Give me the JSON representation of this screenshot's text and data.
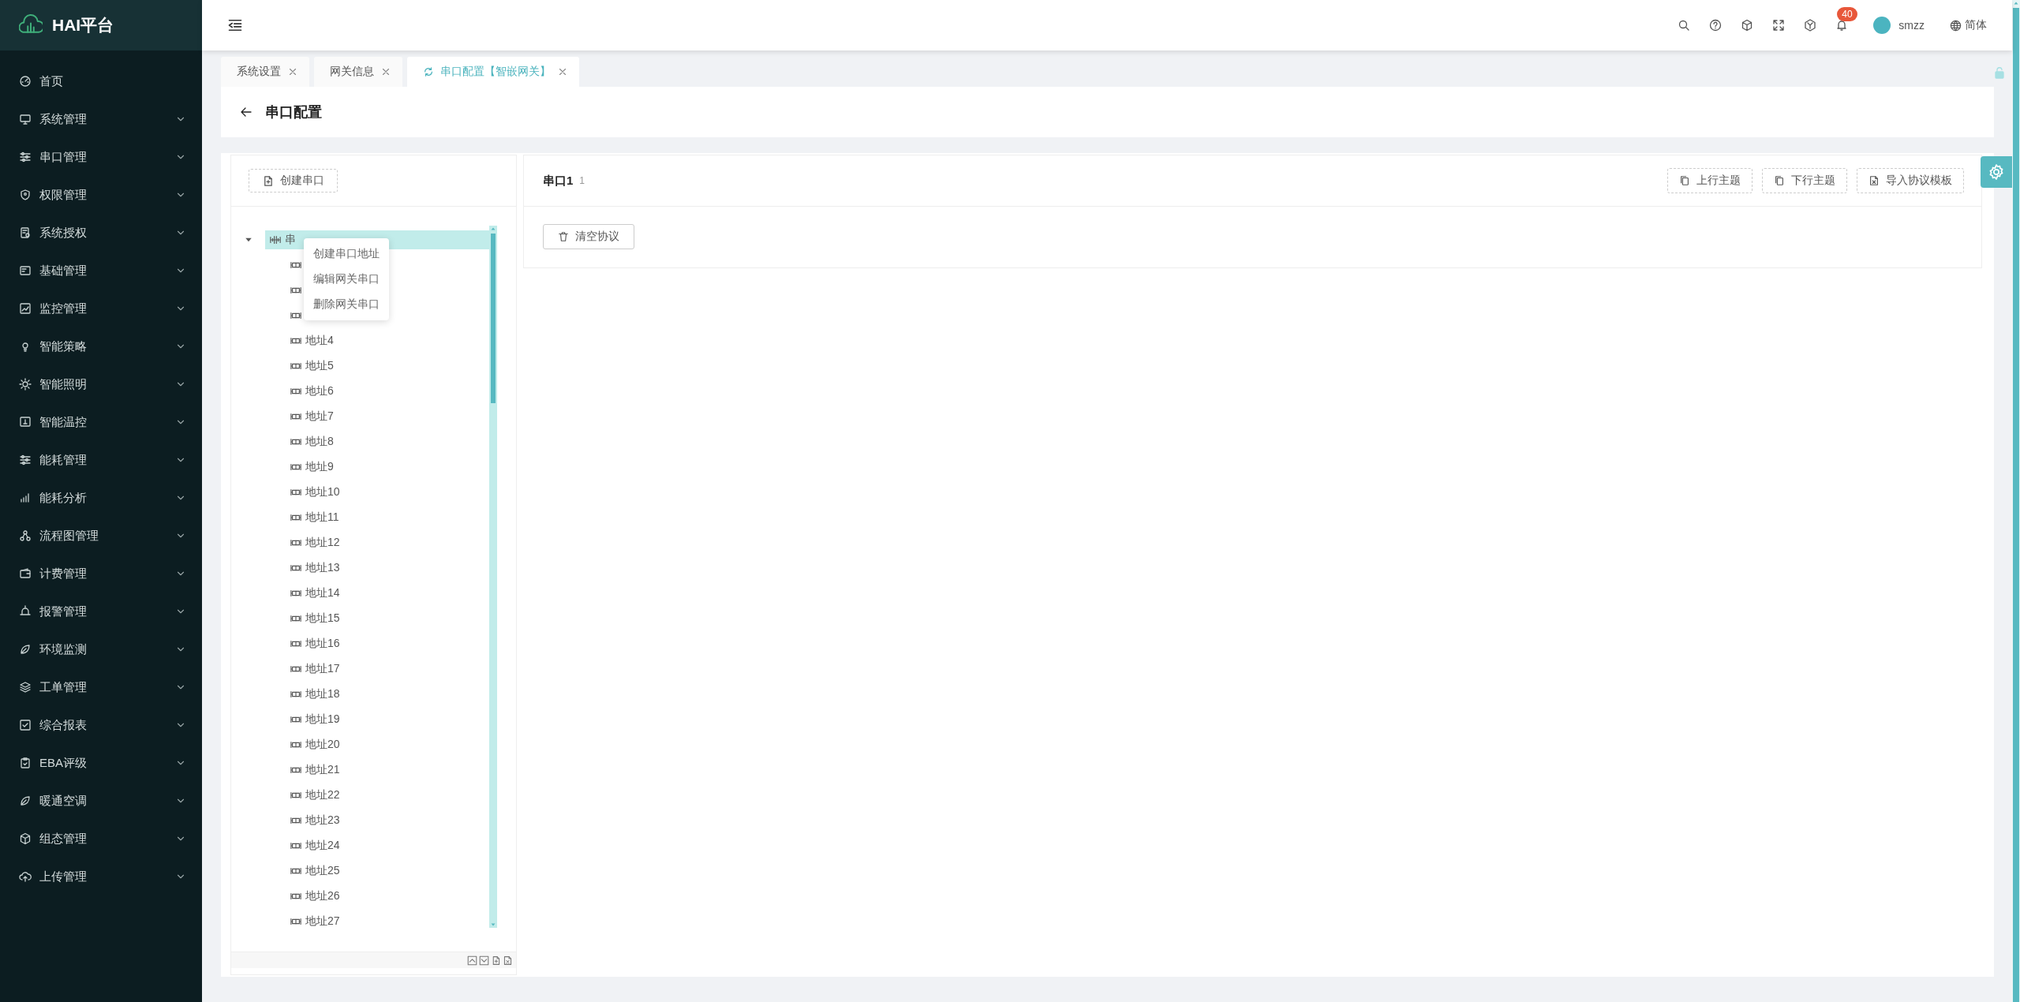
{
  "logo": {
    "title": "HAI平台"
  },
  "sidebar": {
    "items": [
      {
        "label": "首页",
        "kind": "link"
      },
      {
        "label": "系统管理",
        "kind": "group",
        "expanded": false
      },
      {
        "label": "串口管理",
        "kind": "group",
        "expanded": false
      },
      {
        "label": "权限管理",
        "kind": "group",
        "expanded": false
      },
      {
        "label": "系统授权",
        "kind": "group",
        "expanded": false
      },
      {
        "label": "基础管理",
        "kind": "group",
        "expanded": false
      },
      {
        "label": "监控管理",
        "kind": "group",
        "expanded": false
      },
      {
        "label": "智能策略",
        "kind": "group",
        "expanded": false
      },
      {
        "label": "智能照明",
        "kind": "group",
        "expanded": false
      },
      {
        "label": "智能温控",
        "kind": "group",
        "expanded": false
      },
      {
        "label": "能耗管理",
        "kind": "group",
        "expanded": false
      },
      {
        "label": "能耗分析",
        "kind": "group",
        "expanded": false
      },
      {
        "label": "流程图管理",
        "kind": "group",
        "expanded": false
      },
      {
        "label": "计费管理",
        "kind": "group",
        "expanded": false
      },
      {
        "label": "报警管理",
        "kind": "group",
        "expanded": false
      },
      {
        "label": "环境监测",
        "kind": "group",
        "expanded": false
      },
      {
        "label": "工单管理",
        "kind": "group",
        "expanded": false
      },
      {
        "label": "综合报表",
        "kind": "group",
        "expanded": false
      },
      {
        "label": "EBA评级",
        "kind": "group",
        "expanded": false
      },
      {
        "label": "暖通空调",
        "kind": "group",
        "expanded": false
      },
      {
        "label": "组态管理",
        "kind": "group",
        "expanded": false
      },
      {
        "label": "上传管理",
        "kind": "group",
        "expanded": false
      }
    ]
  },
  "topbar": {
    "notifications": "40",
    "user": "smzz",
    "language": "简体"
  },
  "tabs": [
    {
      "label": "系统设置",
      "selected": false
    },
    {
      "label": "网关信息",
      "selected": false
    },
    {
      "label": "串口配置【智嵌网关】",
      "selected": true
    }
  ],
  "page": {
    "title": "串口配置"
  },
  "tree_panel": {
    "create_button": "创建串口",
    "tree": {
      "label": "串",
      "expanded": true,
      "selected": true,
      "children": [
        {
          "selected": false
        },
        {
          "selected": false
        },
        {
          "selected": false
        },
        {
          "label": "地址4",
          "selected": false
        },
        {
          "label": "地址5",
          "selected": false
        },
        {
          "label": "地址6",
          "selected": false
        },
        {
          "label": "地址7",
          "selected": false
        },
        {
          "label": "地址8",
          "selected": false
        },
        {
          "label": "地址9",
          "selected": false
        },
        {
          "label": "地址10",
          "selected": false
        },
        {
          "label": "地址11",
          "selected": false
        },
        {
          "label": "地址12",
          "selected": false
        },
        {
          "label": "地址13",
          "selected": false
        },
        {
          "label": "地址14",
          "selected": false
        },
        {
          "label": "地址15",
          "selected": false
        },
        {
          "label": "地址16",
          "selected": false
        },
        {
          "label": "地址17",
          "selected": false
        },
        {
          "label": "地址18",
          "selected": false
        },
        {
          "label": "地址19",
          "selected": false
        },
        {
          "label": "地址20",
          "selected": false
        },
        {
          "label": "地址21",
          "selected": false
        },
        {
          "label": "地址22",
          "selected": false
        },
        {
          "label": "地址23",
          "selected": false
        },
        {
          "label": "地址24",
          "selected": false
        },
        {
          "label": "地址25",
          "selected": false
        },
        {
          "label": "地址26",
          "selected": false
        },
        {
          "label": "地址27",
          "selected": false
        }
      ]
    }
  },
  "context_menu": [
    "创建串口地址",
    "编辑网关串口",
    "删除网关串口"
  ],
  "detail": {
    "title": "串口1",
    "count": "1",
    "buttons": [
      "上行主题",
      "下行主题",
      "导入协议模板"
    ],
    "clear_button": "清空协议"
  }
}
